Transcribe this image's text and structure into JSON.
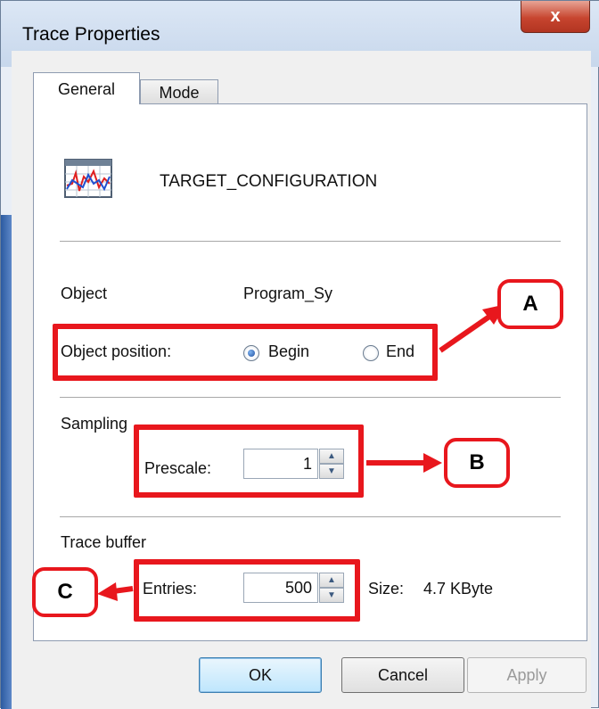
{
  "window": {
    "title": "Trace Properties",
    "close_glyph": "x"
  },
  "tabs": [
    {
      "label": "General"
    },
    {
      "label": "Mode"
    }
  ],
  "header": {
    "icon": "trace-chart-icon",
    "config_name": "TARGET_CONFIGURATION"
  },
  "object": {
    "label": "Object",
    "value": "Program_Sy",
    "position_label": "Object position:",
    "options": [
      {
        "label": "Begin",
        "checked": true
      },
      {
        "label": "End",
        "checked": false
      }
    ]
  },
  "sampling": {
    "group_label": "Sampling",
    "prescale_label": "Prescale:",
    "prescale_value": "1"
  },
  "trace_buffer": {
    "group_label": "Trace buffer",
    "entries_label": "Entries:",
    "entries_value": "500",
    "size_label": "Size:",
    "size_value": "4.7 KByte"
  },
  "callouts": {
    "a": "A",
    "b": "B",
    "c": "C"
  },
  "buttons": {
    "ok": "OK",
    "cancel": "Cancel",
    "apply": "Apply"
  },
  "colors": {
    "annotation_red": "#e8171d",
    "close_button": "#c7452f"
  }
}
